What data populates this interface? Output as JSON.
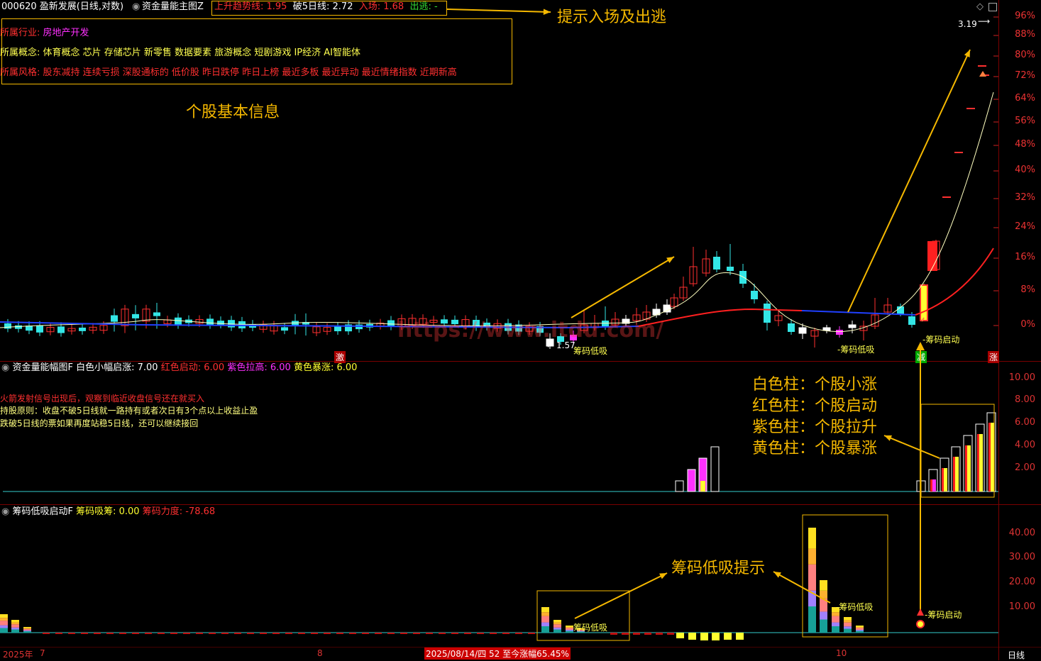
{
  "header": {
    "stock": "000620 盈新发展(日线,对数)",
    "indicator": "资金量能主图Z",
    "signals": [
      {
        "label": "上升趋势线: 1.95",
        "color": "#ff3030"
      },
      {
        "label": "破5日线: 2.72",
        "color": "#ffffff"
      },
      {
        "label": "入场: 1.68",
        "color": "#ff3030"
      },
      {
        "label": "出逃: -",
        "color": "#33dd33"
      }
    ]
  },
  "info": {
    "industry_label": "所属行业:",
    "industry": "房地产开发",
    "concept_label": "所属概念:",
    "concept": "体育概念 芯片 存储芯片 新零售 数据要素 旅游概念 短剧游戏 IP经济 AI智能体",
    "style_label": "所属风格:",
    "style": "股东减持 连续亏损 深股通标的 低价股 昨日跌停 昨日上榜 最近多板 最近异动 最近情绪指数 近期新高"
  },
  "annotations": {
    "entry_exit": "提示入场及出逃",
    "basic_info": "个股基本信息",
    "chip_low": "筹码低吸提示",
    "legend_white": "白色柱：个股小涨",
    "legend_red": "红色柱：个股启动",
    "legend_purple": "紫色柱：个股拉升",
    "legend_yellow": "黄色柱：个股暴涨"
  },
  "main_chart": {
    "price_tag": "3.19",
    "low_tag": "1.57",
    "label_chip_low_1": "筹码低吸",
    "label_chip_low_2": "-筹码低吸",
    "label_chip_start": "-筹码启动",
    "watermark": "https://www.itdu.com/",
    "badge_1": "激",
    "badge_2": "减",
    "badge_3": "涨",
    "y_axis": [
      "96%",
      "88%",
      "80%",
      "72%",
      "64%",
      "56%",
      "48%",
      "40%",
      "32%",
      "24%",
      "16%",
      "8%",
      "0%"
    ]
  },
  "panel2": {
    "title": "资金量能幅图F",
    "vals": [
      {
        "label": "白色小幅启涨: 7.00",
        "color": "#ffffff"
      },
      {
        "label": "红色启动: 6.00",
        "color": "#ff3030"
      },
      {
        "label": "紫色拉高: 6.00",
        "color": "#ff30ff"
      },
      {
        "label": "黄色暴涨: 6.00",
        "color": "#ffff30"
      }
    ],
    "notes": [
      {
        "text": "火箭发射信号出现后，观察到临近收盘信号还在就买入",
        "color": "#ff3030"
      },
      {
        "text": "持股原则：收盘不破5日线就一路持有或者次日有3个点以上收益止盈",
        "color": "#ffff80"
      },
      {
        "text": "跌破5日线的票如果再度站稳5日线，还可以继续接回",
        "color": "#ffff80"
      }
    ],
    "y_axis": [
      "10.00",
      "8.00",
      "6.00",
      "4.00",
      "2.00"
    ]
  },
  "panel3": {
    "title": "筹码低吸启动F",
    "vals": [
      {
        "label": "筹码吸筹: 0.00",
        "color": "#ffff30"
      },
      {
        "label": "筹码力度: -78.68",
        "color": "#ff3030"
      }
    ],
    "label_low_1": "筹码低吸",
    "label_low_2": "-筹码低吸",
    "label_start": "-筹码启动",
    "y_axis": [
      "40.00",
      "30.00",
      "20.00",
      "10.00"
    ]
  },
  "footer": {
    "year": "2025年",
    "m7": "7",
    "m8": "8",
    "m10": "10",
    "status": "2025/08/14/四 52 至今涨幅65.45%",
    "period": "日线"
  }
}
